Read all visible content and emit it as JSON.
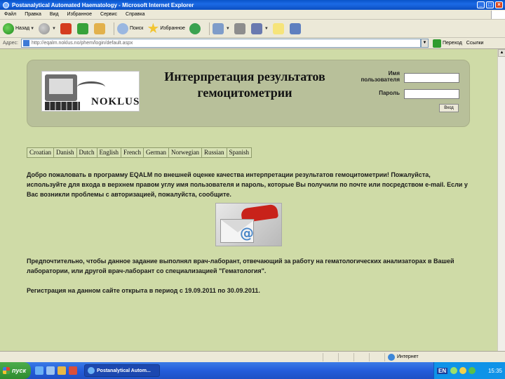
{
  "window": {
    "title": "Postanalytical Automated Haematology - Microsoft Internet Explorer"
  },
  "menu": [
    "Файл",
    "Правка",
    "Вид",
    "Избранное",
    "Сервис",
    "Справка"
  ],
  "toolbar": {
    "back_label": "Назад",
    "search_label": "Поиск",
    "favorites_label": "Избранное"
  },
  "address_bar": {
    "label": "Адрес:",
    "url": "http://eqalm.noklus.no/phem/login/default.aspx",
    "go_label": "Переход",
    "links_label": "Ссылки"
  },
  "page": {
    "header_title_line1": "Интерпретация результатов",
    "header_title_line2": "гемоцитометрии",
    "logo_text": "NOKLUS",
    "username_label_line1": "Имя",
    "username_label_line2": "пользователя",
    "password_label": "Пароль",
    "login_button": "Вход",
    "languages": [
      "Croatian",
      "Danish",
      "Dutch",
      "English",
      "French",
      "German",
      "Norwegian",
      "Russian",
      "Spanish"
    ],
    "welcome_text": "Добро пожаловать в программу EQALM по внешней оценке качества интерпретации результатов гемоцитометрии! Пожалуйста, используйте для входа в верхнем правом углу имя пользователя и пароль, которые Вы получили по почте или посредством e-mail. Если у Вас возникли проблемы с авторизацией, пожалуйста, сообщите.",
    "email_image_symbol": "@",
    "preference_text": "Предпочтительно, чтобы данное задание выполнял врач-лаборант, отвечающий за работу на гематологических анализаторах в Вашей лаборатории, или другой врач-лаборант со специализацией \"Гематология\".",
    "registration_text": "Регистрация на данном сайте открыта в период с 19.09.2011 по 30.09.2011."
  },
  "status_bar": {
    "zone_label": "Интернет"
  },
  "taskbar": {
    "start_label": "пуск",
    "task_label": "Postanalytical Autom...",
    "language": "EN",
    "clock": "15:35"
  },
  "colors": {
    "page_background": "#cfdba7",
    "header_panel": "#b8c09a",
    "title_bar": "#0a54c8"
  }
}
